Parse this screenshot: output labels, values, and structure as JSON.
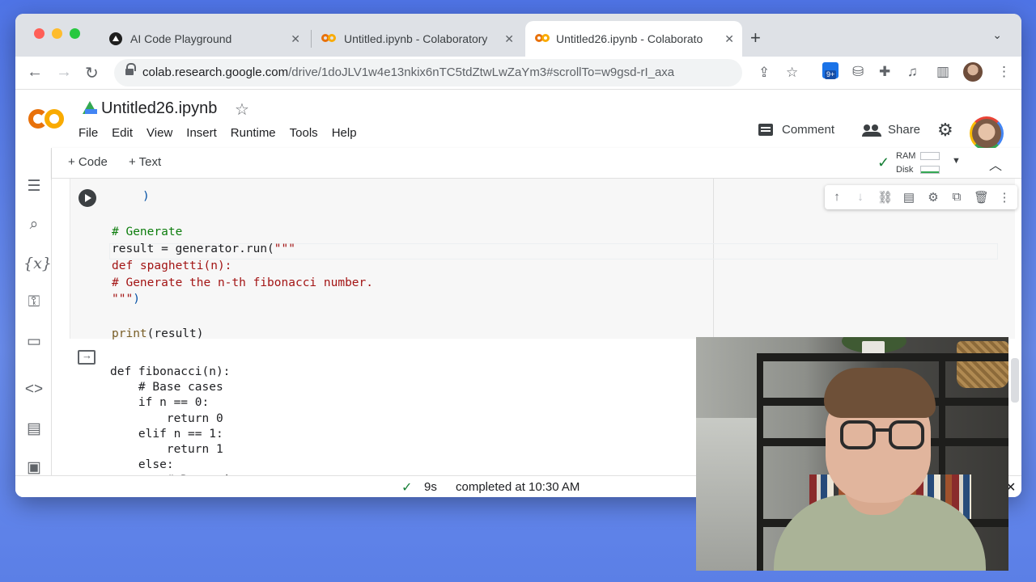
{
  "browser": {
    "tabs": [
      {
        "label": "AI Code Playground",
        "active": false
      },
      {
        "label": "Untitled.ipynb - Colaboratory",
        "active": false
      },
      {
        "label": "Untitled26.ipynb - Colaborato",
        "active": true
      }
    ],
    "url_domain": "colab.research.google.com",
    "url_path": "/drive/1doJLV1w4e13nkix6nTC5tdZtwLwZaYm3#scrollTo=w9gsd-rI_axa",
    "ext_badge": "9+"
  },
  "header": {
    "notebook_title": "Untitled26.ipynb",
    "menu": [
      "File",
      "Edit",
      "View",
      "Insert",
      "Runtime",
      "Tools",
      "Help"
    ],
    "comment_label": "Comment",
    "share_label": "Share"
  },
  "cell_toolbar": {
    "add_code": "+ Code",
    "add_text": "+ Text",
    "ram_label": "RAM",
    "disk_label": "Disk"
  },
  "code_cell": {
    "line_0": ")",
    "line_1": "# Generate",
    "line_2a": "result = generator.run(",
    "line_2b": "\"\"\"",
    "line_3": "def spaghetti(n):",
    "line_4": "# Generate the n-th fibonacci number.",
    "line_5a": "\"\"\"",
    "line_5b": ")",
    "line_6a": "print",
    "line_6b": "(result)"
  },
  "output": {
    "text": "def fibonacci(n):\n    # Base cases\n    if n == 0:\n        return 0\n    elif n == 1:\n        return 1\n    else:\n        # Recursive case"
  },
  "status": {
    "duration": "9s",
    "message": "completed at 10:30 AM"
  },
  "colors": {
    "accent_orange": "#e8710a",
    "accent_yellow": "#f9ab00",
    "success_green": "#188038",
    "comment_green": "#0d7d0d",
    "string_red": "#a31515"
  }
}
